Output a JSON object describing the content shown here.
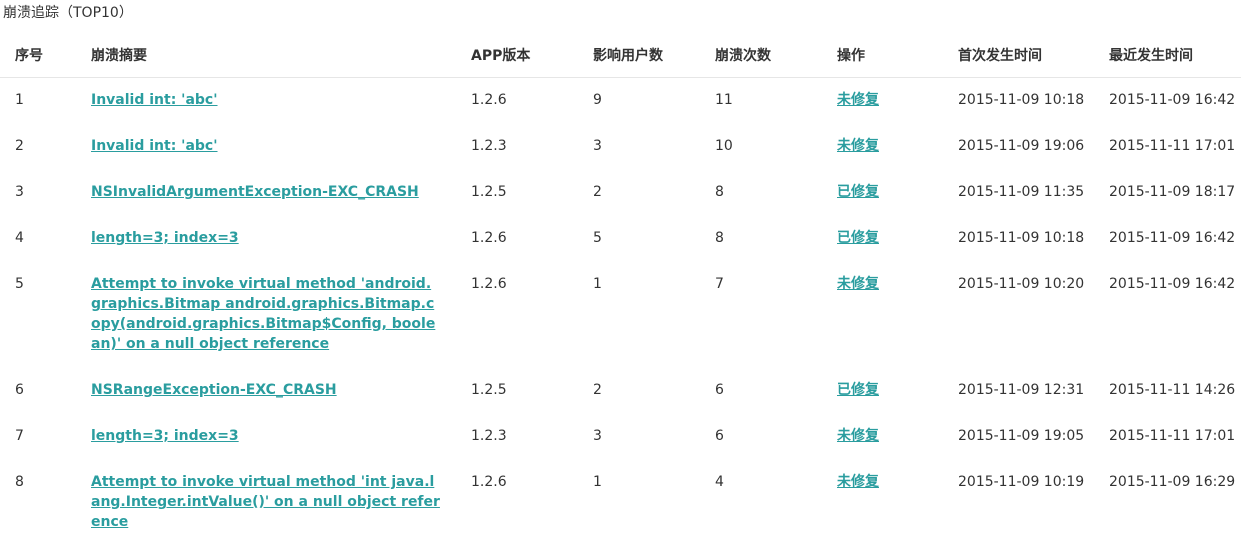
{
  "title": "崩溃追踪（TOP10）",
  "accent_color": "#2a9d9f",
  "columns": {
    "index": "序号",
    "summary": "崩溃摘要",
    "version": "APP版本",
    "users": "影响用户数",
    "count": "崩溃次数",
    "action": "操作",
    "first_time": "首次发生时间",
    "last_time": "最近发生时间"
  },
  "rows": [
    {
      "index": "1",
      "summary": "Invalid int: 'abc'",
      "version": "1.2.6",
      "users": "9",
      "count": "11",
      "action": "未修复",
      "first_time": "2015-11-09 10:18",
      "last_time": "2015-11-09 16:42"
    },
    {
      "index": "2",
      "summary": "Invalid int: 'abc'",
      "version": "1.2.3",
      "users": "3",
      "count": "10",
      "action": "未修复",
      "first_time": "2015-11-09 19:06",
      "last_time": "2015-11-11 17:01"
    },
    {
      "index": "3",
      "summary": "NSInvalidArgumentException-EXC_CRASH",
      "version": "1.2.5",
      "users": "2",
      "count": "8",
      "action": "已修复",
      "first_time": "2015-11-09 11:35",
      "last_time": "2015-11-09 18:17"
    },
    {
      "index": "4",
      "summary": "length=3; index=3",
      "version": "1.2.6",
      "users": "5",
      "count": "8",
      "action": "已修复",
      "first_time": "2015-11-09 10:18",
      "last_time": "2015-11-09 16:42"
    },
    {
      "index": "5",
      "summary": "Attempt to invoke virtual method 'android.graphics.Bitmap android.graphics.Bitmap.copy(android.graphics.Bitmap$Config, boolean)' on a null object reference",
      "version": "1.2.6",
      "users": "1",
      "count": "7",
      "action": "未修复",
      "first_time": "2015-11-09 10:20",
      "last_time": "2015-11-09 16:42"
    },
    {
      "index": "6",
      "summary": "NSRangeException-EXC_CRASH",
      "version": "1.2.5",
      "users": "2",
      "count": "6",
      "action": "已修复",
      "first_time": "2015-11-09 12:31",
      "last_time": "2015-11-11 14:26"
    },
    {
      "index": "7",
      "summary": "length=3; index=3",
      "version": "1.2.3",
      "users": "3",
      "count": "6",
      "action": "未修复",
      "first_time": "2015-11-09 19:05",
      "last_time": "2015-11-11 17:01"
    },
    {
      "index": "8",
      "summary": "Attempt to invoke virtual method 'int java.lang.Integer.intValue()' on a null object reference",
      "version": "1.2.6",
      "users": "1",
      "count": "4",
      "action": "未修复",
      "first_time": "2015-11-09 10:19",
      "last_time": "2015-11-09 16:29"
    }
  ]
}
